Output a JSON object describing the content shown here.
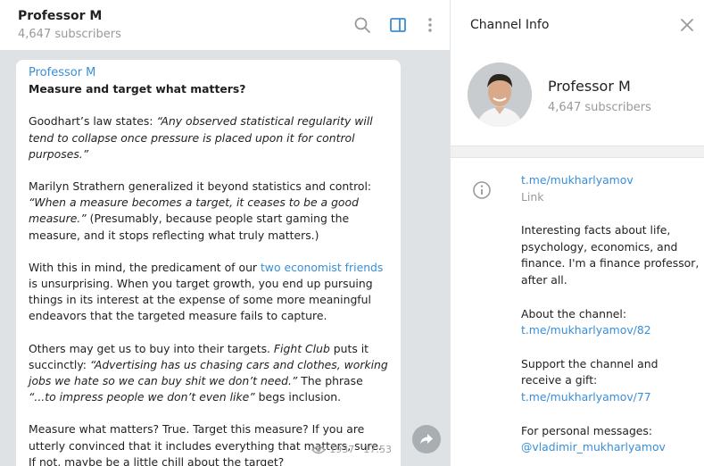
{
  "chat": {
    "title": "Professor M",
    "subscribers": "4,647 subscribers"
  },
  "message": {
    "author": "Professor M",
    "headline": "Measure and target what matters?",
    "p1_a": "Goodhart’s law states: ",
    "p1_b": "“Any observed statistical regularity will tend to collapse once pressure is placed upon it for control purposes.”",
    "p2_a": "Marilyn Strathern generalized it beyond statistics and control: ",
    "p2_b": "“When a measure becomes a target, it ceases to be a good measure.”",
    "p2_c": " (Presumably, because people start gaming the measure, and it stops reflecting what truly matters.)",
    "p3_a": "With this in mind, the predicament of our ",
    "p3_link": "two economist friends",
    "p3_b": " is unsurprising. When you target growth, you end up pursuing things in its interest at the expense of some more meaningful endeavors that the targeted measure fails to capture.",
    "p4_a": "Others may get us to buy into their targets. ",
    "p4_b": "Fight Club",
    "p4_c": " puts it succinctly: ",
    "p4_d": "“Advertising has us chasing cars and clothes, working jobs we hate so we can buy shit we don’t need.”",
    "p4_e": " The phrase ",
    "p4_f": "“...to impress people we don’t even like”",
    "p4_g": " begs inclusion.",
    "p5": "Measure what matters? True. Target this measure? If you are utterly convinced that it includes everything that matters, sure. If not, maybe be a little chill about the target?",
    "views": "1937",
    "time": "17:53"
  },
  "info": {
    "title": "Channel Info",
    "name": "Professor M",
    "subscribers": "4,647 subscribers",
    "link": "t.me/mukharlyamov",
    "link_label": "Link",
    "description": "Interesting facts about life, psychology, economics, and finance. I'm a finance professor, after all.",
    "about_label": "About the channel:",
    "about_link": "t.me/mukharlyamov/82",
    "support_label": "Support the channel and receive a gift:",
    "support_link": "t.me/mukharlyamov/77",
    "personal_label": "For personal messages:",
    "personal_link": "@vladimir_mukharlyamov"
  },
  "colors": {
    "accent": "#3a8ed6",
    "chat_background": "#dfe2e4",
    "muted_text": "#999999"
  },
  "icons": [
    "search-icon",
    "side-panel-icon",
    "more-vertical-icon",
    "eye-icon",
    "forward-icon",
    "close-icon",
    "info-icon"
  ]
}
